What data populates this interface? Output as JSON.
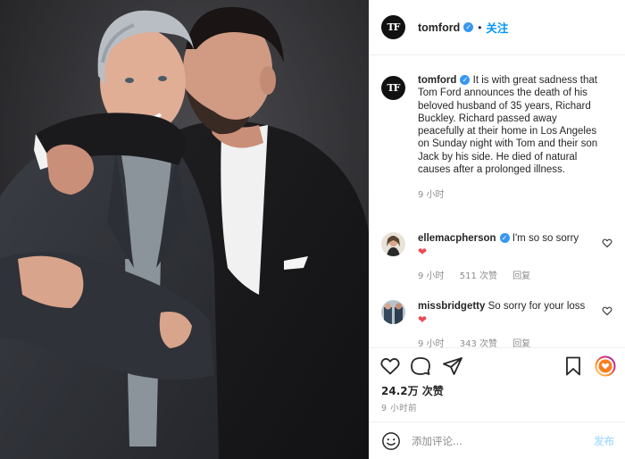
{
  "post": {
    "username": "tomford",
    "avatar_text": "TF",
    "follow_label": "关注",
    "separator": "•"
  },
  "caption": {
    "username": "tomford",
    "text": "It is with great sadness that Tom Ford announces the death of his beloved husband of 35 years, Richard Buckley. Richard passed away peacefully at their home in Los Angeles on Sunday night with Tom and their son Jack by his side. He died of natural causes after a prolonged illness.",
    "time": "9 小时"
  },
  "comments": [
    {
      "username": "ellemacpherson",
      "verified": true,
      "text": "I'm so so sorry",
      "emoji": "❤",
      "time": "9 小时",
      "likes": "511 次赞",
      "reply": "回复"
    },
    {
      "username": "missbridgetty",
      "verified": false,
      "text": "So sorry for your loss",
      "emoji": "❤",
      "time": "9 小时",
      "likes": "343 次赞",
      "reply": "回复"
    }
  ],
  "actions": {
    "likes": "24.2万 次赞",
    "time": "9 小时前",
    "comment_placeholder": "添加评论...",
    "post_label": "发布"
  },
  "icons": {
    "verified": "verified-badge-icon",
    "like": "heart-icon",
    "comment": "comment-bubble-icon",
    "share": "paper-plane-icon",
    "save": "bookmark-icon",
    "emoji": "emoji-smile-icon"
  },
  "colors": {
    "accent": "#0095f6",
    "verified": "#3897f0",
    "heart": "#ed4956",
    "muted": "#8e8e8e",
    "post_disabled": "#b2dffc"
  }
}
